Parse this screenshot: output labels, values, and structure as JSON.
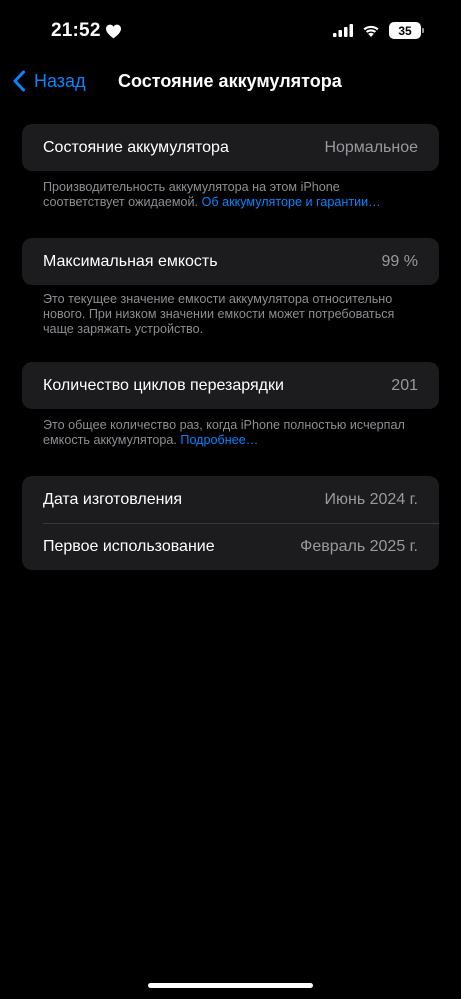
{
  "status_bar": {
    "time": "21:52",
    "battery_level": "35"
  },
  "nav": {
    "back_label": "Назад",
    "title": "Состояние аккумулятора"
  },
  "battery_health": {
    "label": "Состояние аккумулятора",
    "value": "Нормальное",
    "footnote": "Производительность аккумулятора на этом iPhone соответствует ожидаемой.",
    "footnote_link": "Об аккумуляторе и гарантии…"
  },
  "max_capacity": {
    "label": "Максимальная емкость",
    "value": "99 %",
    "footnote": "Это текущее значение емкости аккумулятора относительно нового. При низком значении емкости может потребоваться чаще заряжать устройство."
  },
  "cycle_count": {
    "label": "Количество циклов перезарядки",
    "value": "201",
    "footnote": "Это общее количество раз, когда iPhone полностью исчерпал емкость аккумулятора.",
    "footnote_link": "Подробнее…"
  },
  "dates": {
    "manufacture_label": "Дата изготовления",
    "manufacture_value": "Июнь 2024 г.",
    "first_use_label": "Первое использование",
    "first_use_value": "Февраль 2025 г."
  },
  "colors": {
    "accent": "#0a84ff",
    "background": "#000000",
    "group_background": "#1c1c1e",
    "secondary_text": "#98989f"
  },
  "icons": {
    "status_heart": "heart-icon",
    "signal": "cellular-signal-icon",
    "wifi": "wifi-icon",
    "battery": "battery-icon",
    "back": "chevron-left-icon"
  }
}
